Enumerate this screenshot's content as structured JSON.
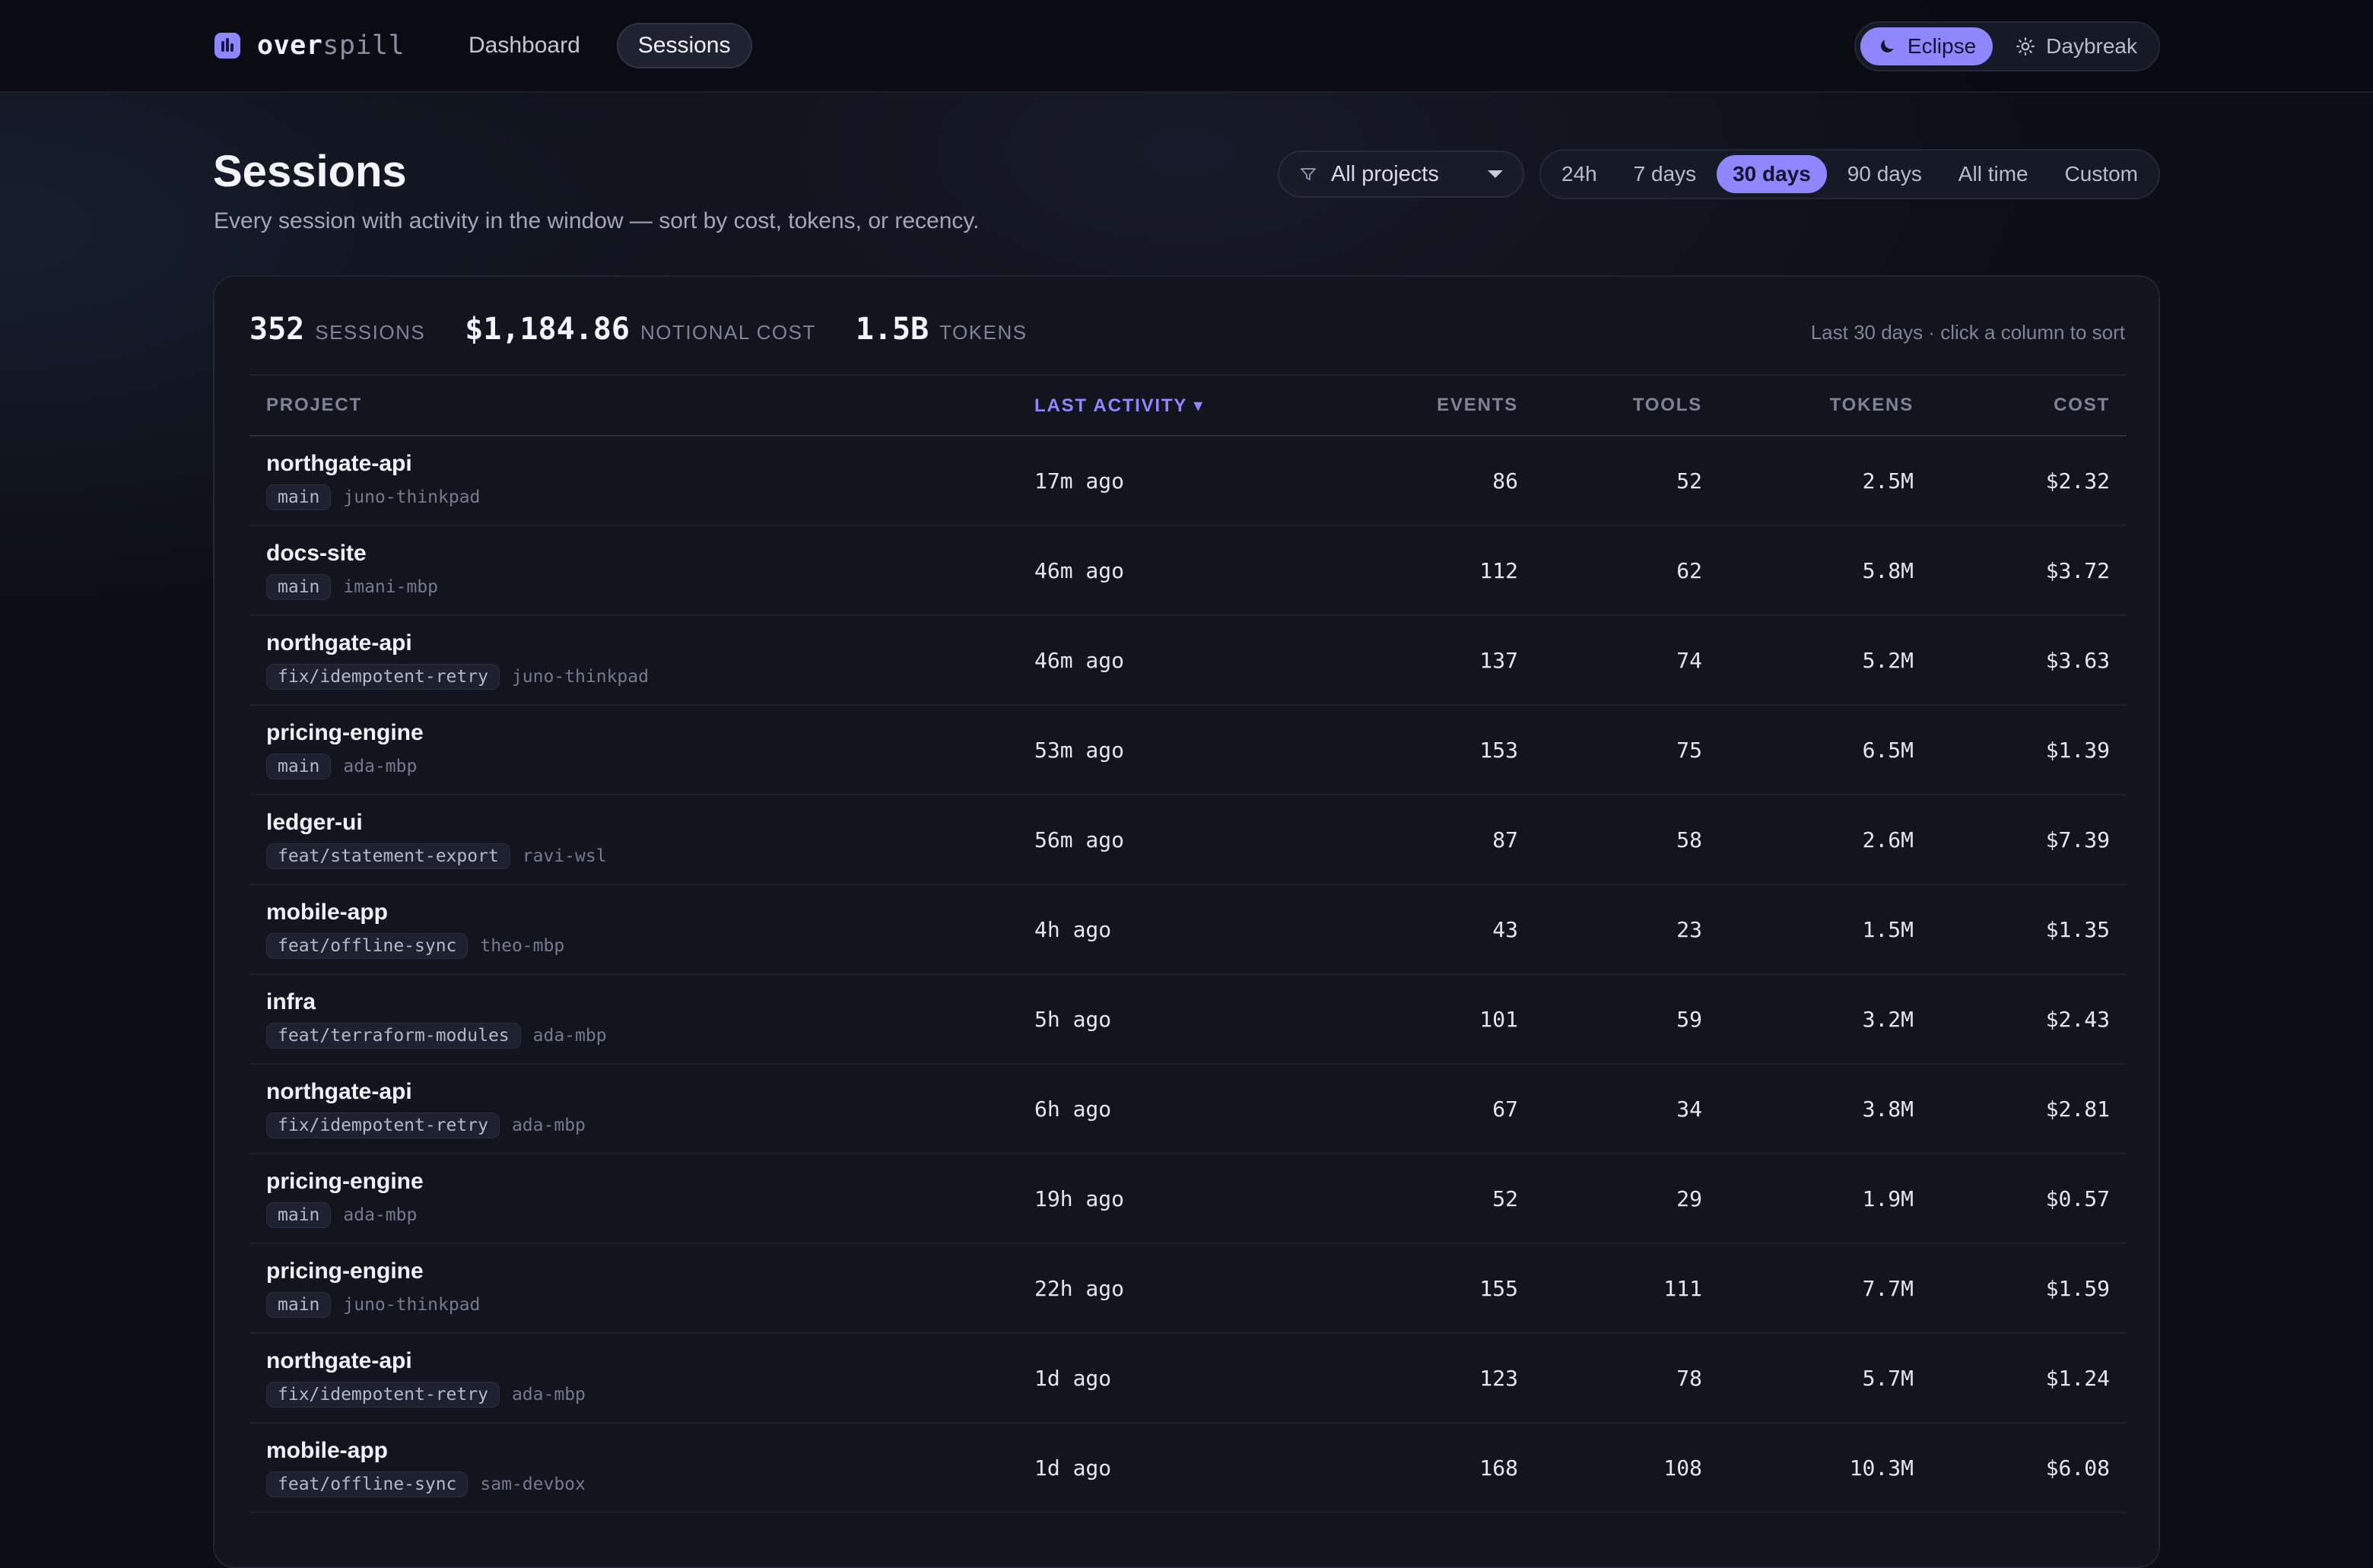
{
  "app": {
    "logo_part1": "over",
    "logo_part2": "spill"
  },
  "nav": {
    "links": [
      {
        "label": "Dashboard",
        "active": false
      },
      {
        "label": "Sessions",
        "active": true
      }
    ]
  },
  "theme": {
    "options": [
      {
        "label": "Eclipse",
        "icon": "moon-icon",
        "active": true
      },
      {
        "label": "Daybreak",
        "icon": "sun-icon",
        "active": false
      }
    ]
  },
  "header": {
    "title": "Sessions",
    "subtitle": "Every session with activity in the window — sort by cost, tokens, or recency."
  },
  "filters": {
    "project_select": "All projects",
    "ranges": [
      {
        "label": "24h",
        "active": false
      },
      {
        "label": "7 days",
        "active": false
      },
      {
        "label": "30 days",
        "active": true
      },
      {
        "label": "90 days",
        "active": false
      },
      {
        "label": "All time",
        "active": false
      },
      {
        "label": "Custom",
        "active": false
      }
    ]
  },
  "summary": {
    "sessions_value": "352",
    "sessions_label": "SESSIONS",
    "cost_value": "$1,184.86",
    "cost_label": "NOTIONAL COST",
    "tokens_value": "1.5B",
    "tokens_label": "TOKENS",
    "hint": "Last 30 days · click a column to sort"
  },
  "table": {
    "columns": {
      "project": "PROJECT",
      "last_activity": "LAST ACTIVITY ▾",
      "events": "EVENTS",
      "tools": "TOOLS",
      "tokens": "TOKENS",
      "cost": "COST"
    },
    "rows": [
      {
        "project": "northgate-api",
        "branch": "main",
        "host": "juno-thinkpad",
        "activity": "17m ago",
        "events": "86",
        "tools": "52",
        "tokens": "2.5M",
        "cost": "$2.32"
      },
      {
        "project": "docs-site",
        "branch": "main",
        "host": "imani-mbp",
        "activity": "46m ago",
        "events": "112",
        "tools": "62",
        "tokens": "5.8M",
        "cost": "$3.72"
      },
      {
        "project": "northgate-api",
        "branch": "fix/idempotent-retry",
        "host": "juno-thinkpad",
        "activity": "46m ago",
        "events": "137",
        "tools": "74",
        "tokens": "5.2M",
        "cost": "$3.63"
      },
      {
        "project": "pricing-engine",
        "branch": "main",
        "host": "ada-mbp",
        "activity": "53m ago",
        "events": "153",
        "tools": "75",
        "tokens": "6.5M",
        "cost": "$1.39"
      },
      {
        "project": "ledger-ui",
        "branch": "feat/statement-export",
        "host": "ravi-wsl",
        "activity": "56m ago",
        "events": "87",
        "tools": "58",
        "tokens": "2.6M",
        "cost": "$7.39"
      },
      {
        "project": "mobile-app",
        "branch": "feat/offline-sync",
        "host": "theo-mbp",
        "activity": "4h ago",
        "events": "43",
        "tools": "23",
        "tokens": "1.5M",
        "cost": "$1.35"
      },
      {
        "project": "infra",
        "branch": "feat/terraform-modules",
        "host": "ada-mbp",
        "activity": "5h ago",
        "events": "101",
        "tools": "59",
        "tokens": "3.2M",
        "cost": "$2.43"
      },
      {
        "project": "northgate-api",
        "branch": "fix/idempotent-retry",
        "host": "ada-mbp",
        "activity": "6h ago",
        "events": "67",
        "tools": "34",
        "tokens": "3.8M",
        "cost": "$2.81"
      },
      {
        "project": "pricing-engine",
        "branch": "main",
        "host": "ada-mbp",
        "activity": "19h ago",
        "events": "52",
        "tools": "29",
        "tokens": "1.9M",
        "cost": "$0.57"
      },
      {
        "project": "pricing-engine",
        "branch": "main",
        "host": "juno-thinkpad",
        "activity": "22h ago",
        "events": "155",
        "tools": "111",
        "tokens": "7.7M",
        "cost": "$1.59"
      },
      {
        "project": "northgate-api",
        "branch": "fix/idempotent-retry",
        "host": "ada-mbp",
        "activity": "1d ago",
        "events": "123",
        "tools": "78",
        "tokens": "5.7M",
        "cost": "$1.24"
      },
      {
        "project": "mobile-app",
        "branch": "feat/offline-sync",
        "host": "sam-devbox",
        "activity": "1d ago",
        "events": "168",
        "tools": "108",
        "tokens": "10.3M",
        "cost": "$6.08"
      }
    ]
  }
}
